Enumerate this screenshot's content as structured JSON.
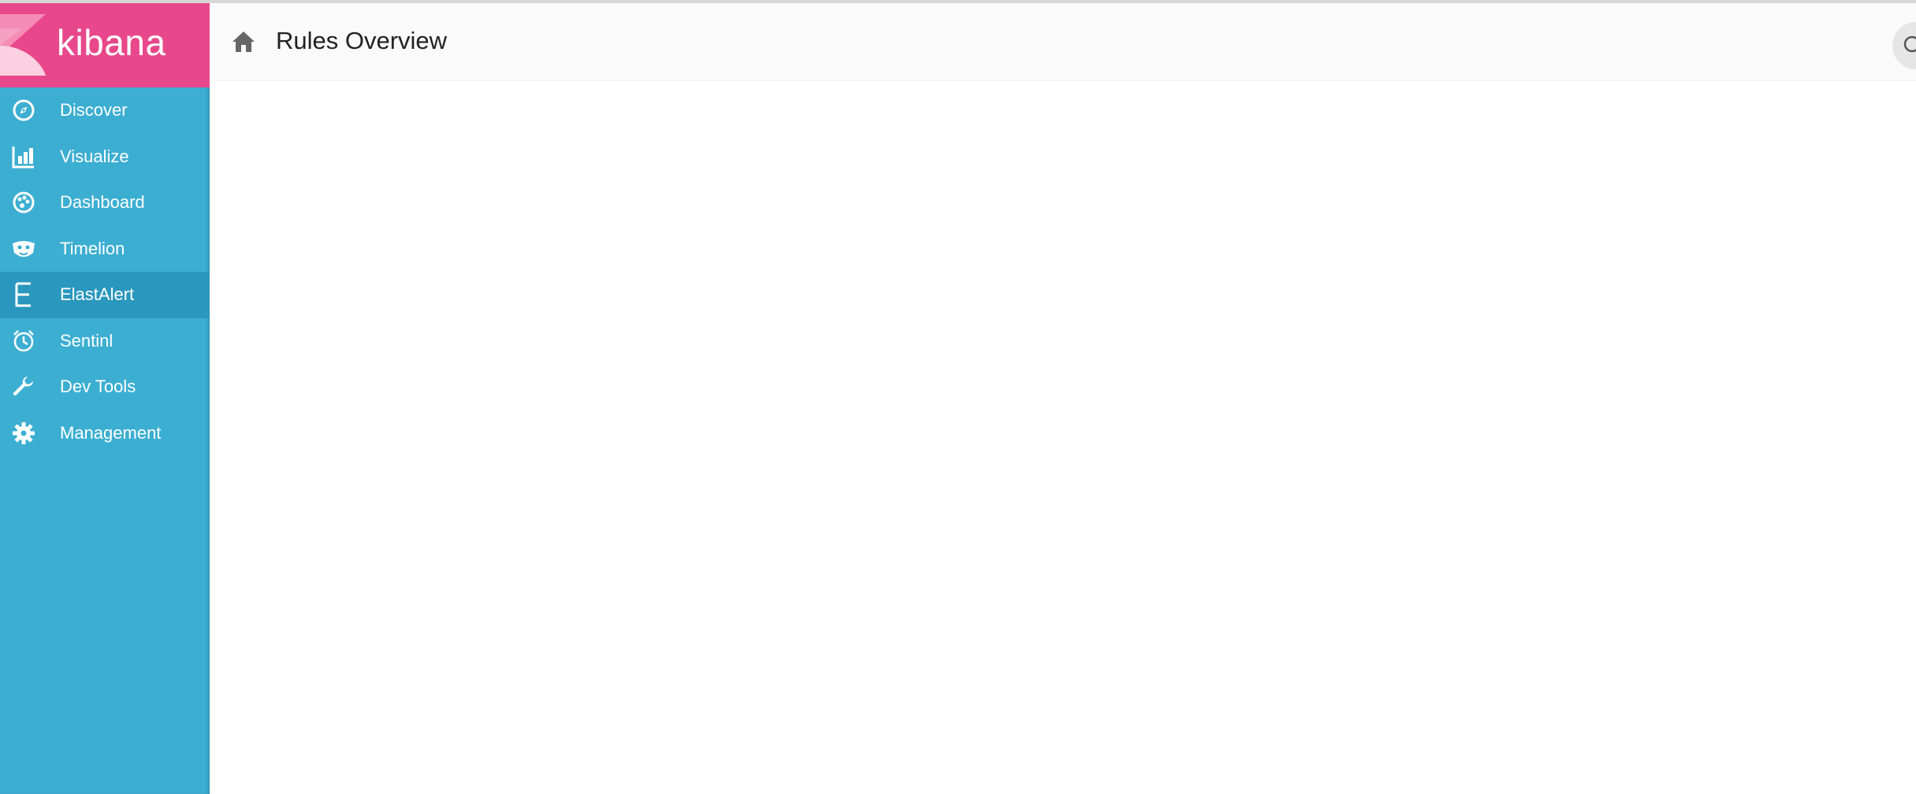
{
  "app": {
    "logo_text": "kibana",
    "brand_color": "#e8488b",
    "sidebar_color": "#3caed2",
    "active_color": "#2a97be"
  },
  "sidebar": {
    "items": [
      {
        "label": "Discover",
        "icon": "compass-icon",
        "active": false
      },
      {
        "label": "Visualize",
        "icon": "bar-chart-icon",
        "active": false
      },
      {
        "label": "Dashboard",
        "icon": "dashboard-gauge-icon",
        "active": false
      },
      {
        "label": "Timelion",
        "icon": "timelion-mask-icon",
        "active": false
      },
      {
        "label": "ElastAlert",
        "icon": "letter-e-icon",
        "active": true
      },
      {
        "label": "Sentinl",
        "icon": "alarm-clock-icon",
        "active": false
      },
      {
        "label": "Dev Tools",
        "icon": "wrench-icon",
        "active": false
      },
      {
        "label": "Management",
        "icon": "gear-icon",
        "active": false
      }
    ]
  },
  "header": {
    "home_icon": "home-icon",
    "title": "Rules Overview",
    "search_icon": "search-icon"
  }
}
